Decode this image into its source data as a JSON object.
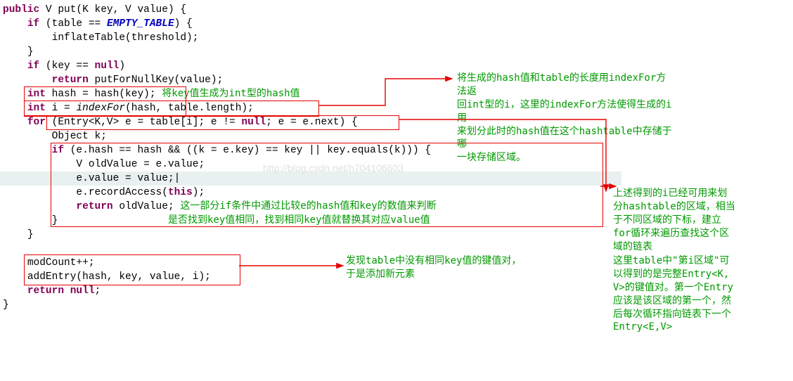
{
  "code": {
    "l1_public": "public",
    "l1_V": "V",
    "l1_put": "put(K key, V value) {",
    "l2_if": "if",
    "l2_rest": " (table == ",
    "l2_empty": "EMPTY_TABLE",
    "l2_end": ") {",
    "l3": "inflateTable(threshold);",
    "l4": "}",
    "l5_if": "if",
    "l5_rest": " (key == ",
    "l5_null": "null",
    "l5_end": ")",
    "l6_ret": "return",
    "l6_rest": " putForNullKey(value);",
    "l7_int": "int",
    "l7_rest": " hash = hash(key);",
    "l8_int": "int",
    "l8_i": " i = ",
    "l8_indexfor": "indexFor",
    "l8_rest": "(hash, table.length);",
    "l9_for": "for",
    "l9_rest1": " (Entry<K,V> e = table[i]; e != ",
    "l9_null": "null",
    "l9_rest2": "; e = e.next) {",
    "l10": "Object k;",
    "l11_if": "if",
    "l11_rest": " (e.hash == hash && ((k = e.key) == key || key.equals(k))) {",
    "l12": "V oldValue = e.value;",
    "l13a": "e.value = value;",
    "l13cursor": "|",
    "l14a": "e.recordAccess(",
    "l14_this": "this",
    "l14b": ");",
    "l15_ret": "return",
    "l15_rest": " oldValue;",
    "l16": "}",
    "l17": "}",
    "l18": "",
    "l19": "modCount++;",
    "l20": "addEntry(hash, key, value, i);",
    "l21_ret": "return",
    "l21_null": "null",
    "l21_end": ";",
    "l22": "}"
  },
  "comments": {
    "c_hash_key": "将key值生成为int型的hash值",
    "c_indexfor_1": "将生成的hash值和table的长度用indexFor方法返",
    "c_indexfor_2": "回int型的i，这里的indexFor方法使得生成的i用",
    "c_indexfor_3": "来划分此时的hash值在这个hashtable中存储于哪",
    "c_indexfor_4": "一块存储区域。",
    "c_loop_1": "上述得到的i已经可用来划",
    "c_loop_2": "分hashtable的区域，相当",
    "c_loop_3": "于不同区域的下标，建立",
    "c_loop_4": "for循环来遍历查找这个区",
    "c_loop_5": "域的链表",
    "c_entry_1": "这里table中\"第i区域\"可",
    "c_entry_2": "以得到的是完整Entry<K,",
    "c_entry_3": "V>的键值对。第一个Entry",
    "c_entry_4": "应该是该区域的第一个，然",
    "c_entry_5": "后每次循环指向链表下一个",
    "c_entry_6": "Entry<E,V>",
    "c_ifblock_1": "这一部分if条件中通过比较e的hash值和key的数值来判断",
    "c_ifblock_2": "是否找到key值相同，找到相同key值就替换其对应value值",
    "c_addentry_1": "发现table中没有相同key值的键值对，",
    "c_addentry_2": "于是添加新元素"
  },
  "watermark": "http://blog.csdn.net/h704106603"
}
